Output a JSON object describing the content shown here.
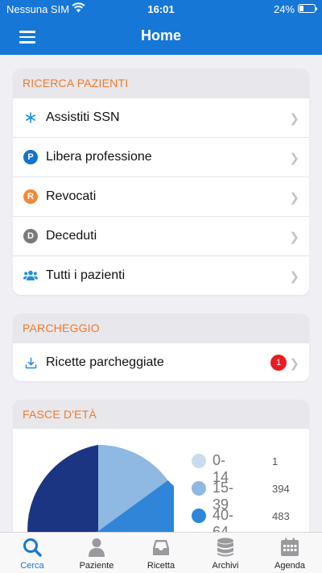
{
  "status_bar": {
    "carrier": "Nessuna SIM",
    "time": "16:01",
    "battery": "24%"
  },
  "nav": {
    "title": "Home",
    "menu_icon": "hamburger-icon"
  },
  "ricerca": {
    "header": "RICERCA PAZIENTI",
    "items": [
      {
        "label": "Assistiti SSN",
        "icon": "asterisk-icon"
      },
      {
        "label": "Libera professione",
        "icon": "p-circle-icon",
        "glyph": "P"
      },
      {
        "label": "Revocati",
        "icon": "r-circle-icon",
        "glyph": "R"
      },
      {
        "label": "Deceduti",
        "icon": "d-circle-icon",
        "glyph": "D"
      },
      {
        "label": "Tutti i pazienti",
        "icon": "users-icon"
      }
    ]
  },
  "parcheggio": {
    "header": "PARCHEGGIO",
    "item": {
      "label": "Ricette parcheggiate",
      "badge": "1",
      "icon": "download-icon"
    }
  },
  "fasce": {
    "header": "FASCE D'ETÀ",
    "legend": [
      {
        "range": "0-14",
        "count": "1"
      },
      {
        "range": "15-39",
        "count": "394"
      },
      {
        "range": "40-64",
        "count": "483"
      }
    ]
  },
  "chart_data": {
    "type": "pie",
    "categories": [
      "0-14",
      "15-39",
      "40-64"
    ],
    "values": [
      1,
      394,
      483
    ],
    "colors": [
      "#c9dcef",
      "#8fb8e2",
      "#2f86d8"
    ],
    "note_visible_slices": [
      "#8fb8e2",
      "#2f86d8",
      "#3468c0",
      "#1b3582"
    ]
  },
  "colors": {
    "accent": "#1677d6",
    "section_header": "#f07a2a",
    "badge": "#ea1c24"
  },
  "tabs": [
    {
      "label": "Cerca",
      "icon": "search-icon",
      "active": true
    },
    {
      "label": "Paziente",
      "icon": "person-icon"
    },
    {
      "label": "Ricetta",
      "icon": "inbox-icon"
    },
    {
      "label": "Archivi",
      "icon": "database-icon"
    },
    {
      "label": "Agenda",
      "icon": "calendar-icon"
    }
  ]
}
